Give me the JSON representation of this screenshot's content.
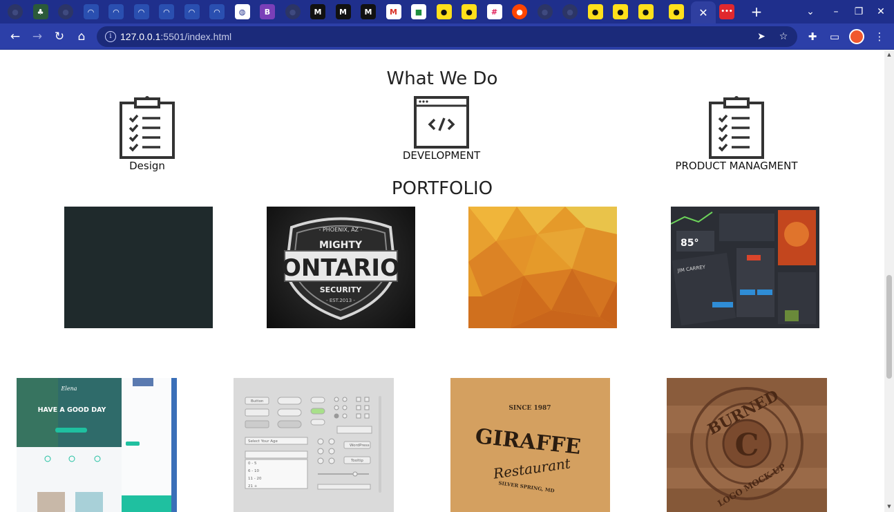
{
  "browser": {
    "tabs": [
      {
        "icon": "github-icon"
      },
      {
        "icon": "tree-icon"
      },
      {
        "icon": "github-icon"
      },
      {
        "icon": "wave-icon"
      },
      {
        "icon": "wave-icon"
      },
      {
        "icon": "wave-icon"
      },
      {
        "icon": "wave-icon"
      },
      {
        "icon": "wave-icon"
      },
      {
        "icon": "wave-icon"
      },
      {
        "icon": "globe-icon"
      },
      {
        "icon": "bootstrap-icon",
        "text": "B"
      },
      {
        "icon": "github-icon"
      },
      {
        "icon": "medium-icon",
        "text": "M"
      },
      {
        "icon": "medium-icon",
        "text": "M"
      },
      {
        "icon": "medium-icon",
        "text": "M"
      },
      {
        "icon": "gmail-icon"
      },
      {
        "icon": "meet-icon"
      },
      {
        "icon": "mailchimp-icon"
      },
      {
        "icon": "mailchimp-icon"
      },
      {
        "icon": "slack-icon"
      },
      {
        "icon": "reddit-icon"
      },
      {
        "icon": "github-icon"
      },
      {
        "icon": "github-icon"
      },
      {
        "icon": "mailchimp-icon"
      },
      {
        "icon": "mailchimp-icon"
      },
      {
        "icon": "mailchimp-icon"
      },
      {
        "icon": "mailchimp-icon"
      }
    ],
    "active_tab_close": "✕",
    "last_tab_icon": "dots-icon",
    "url_host": "127.0.0.1",
    "url_rest": ":5501/index.html",
    "accent": "#2c3fa8"
  },
  "page": {
    "what_we_do_title": "What We Do",
    "services": [
      {
        "label": "Design",
        "icon": "clipboard-checklist-icon"
      },
      {
        "label": "DEVELOPMENT",
        "icon": "code-window-icon"
      },
      {
        "label": "PRODUCT MANAGMENT",
        "icon": "clipboard-checklist-icon"
      }
    ],
    "portfolio_title": "PORTFOLIO",
    "shield_top": "- PHOENIX, AZ -",
    "shield_mighty": "MIGHTY",
    "shield_main": "ONTARIO",
    "shield_security": "SECURITY",
    "shield_est": "- EST.2013 -",
    "weather_temp": "85°",
    "weather_name": "JIM CARREY",
    "web_brand": "Elena",
    "web_headline": "HAVE A GOOD DAY",
    "ui_button": "Button",
    "ui_wordpress": "WordPress",
    "ui_tooltip": "Tooltip",
    "ui_select": "Select Your Age",
    "ui_opt1": "0 - 5",
    "ui_opt2": "6 - 10",
    "ui_opt3": "11 - 20",
    "ui_opt4": "21 +",
    "giraffe_since": "SINCE 1987",
    "giraffe_name": "GIRAFFE",
    "giraffe_sub": "Restaurant",
    "giraffe_loc": "SILVER SPRING, MD",
    "burned_top": "BURNED",
    "burned_letter": "C",
    "burned_bottom": "LOGO MOCK-UP"
  }
}
